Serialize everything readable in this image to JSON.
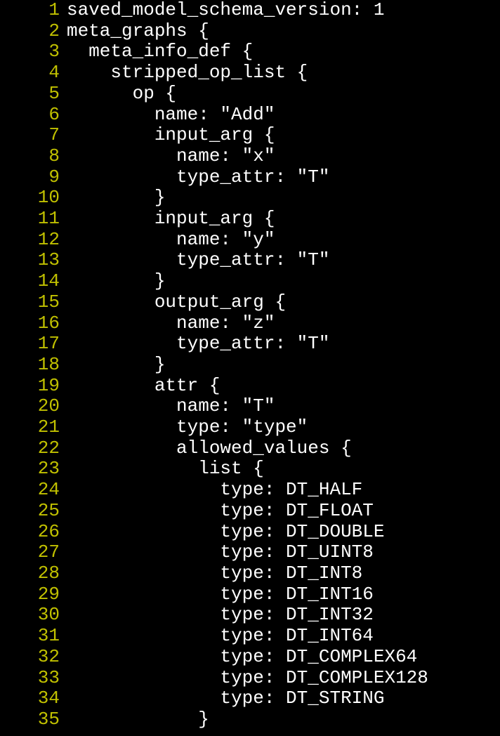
{
  "lines": [
    {
      "num": "1",
      "text": "saved_model_schema_version: 1"
    },
    {
      "num": "2",
      "text": "meta_graphs {"
    },
    {
      "num": "3",
      "text": "  meta_info_def {"
    },
    {
      "num": "4",
      "text": "    stripped_op_list {"
    },
    {
      "num": "5",
      "text": "      op {"
    },
    {
      "num": "6",
      "text": "        name: \"Add\""
    },
    {
      "num": "7",
      "text": "        input_arg {"
    },
    {
      "num": "8",
      "text": "          name: \"x\""
    },
    {
      "num": "9",
      "text": "          type_attr: \"T\""
    },
    {
      "num": "10",
      "text": "        }"
    },
    {
      "num": "11",
      "text": "        input_arg {"
    },
    {
      "num": "12",
      "text": "          name: \"y\""
    },
    {
      "num": "13",
      "text": "          type_attr: \"T\""
    },
    {
      "num": "14",
      "text": "        }"
    },
    {
      "num": "15",
      "text": "        output_arg {"
    },
    {
      "num": "16",
      "text": "          name: \"z\""
    },
    {
      "num": "17",
      "text": "          type_attr: \"T\""
    },
    {
      "num": "18",
      "text": "        }"
    },
    {
      "num": "19",
      "text": "        attr {"
    },
    {
      "num": "20",
      "text": "          name: \"T\""
    },
    {
      "num": "21",
      "text": "          type: \"type\""
    },
    {
      "num": "22",
      "text": "          allowed_values {"
    },
    {
      "num": "23",
      "text": "            list {"
    },
    {
      "num": "24",
      "text": "              type: DT_HALF"
    },
    {
      "num": "25",
      "text": "              type: DT_FLOAT"
    },
    {
      "num": "26",
      "text": "              type: DT_DOUBLE"
    },
    {
      "num": "27",
      "text": "              type: DT_UINT8"
    },
    {
      "num": "28",
      "text": "              type: DT_INT8"
    },
    {
      "num": "29",
      "text": "              type: DT_INT16"
    },
    {
      "num": "30",
      "text": "              type: DT_INT32"
    },
    {
      "num": "31",
      "text": "              type: DT_INT64"
    },
    {
      "num": "32",
      "text": "              type: DT_COMPLEX64"
    },
    {
      "num": "33",
      "text": "              type: DT_COMPLEX128"
    },
    {
      "num": "34",
      "text": "              type: DT_STRING"
    },
    {
      "num": "35",
      "text": "            }"
    }
  ]
}
